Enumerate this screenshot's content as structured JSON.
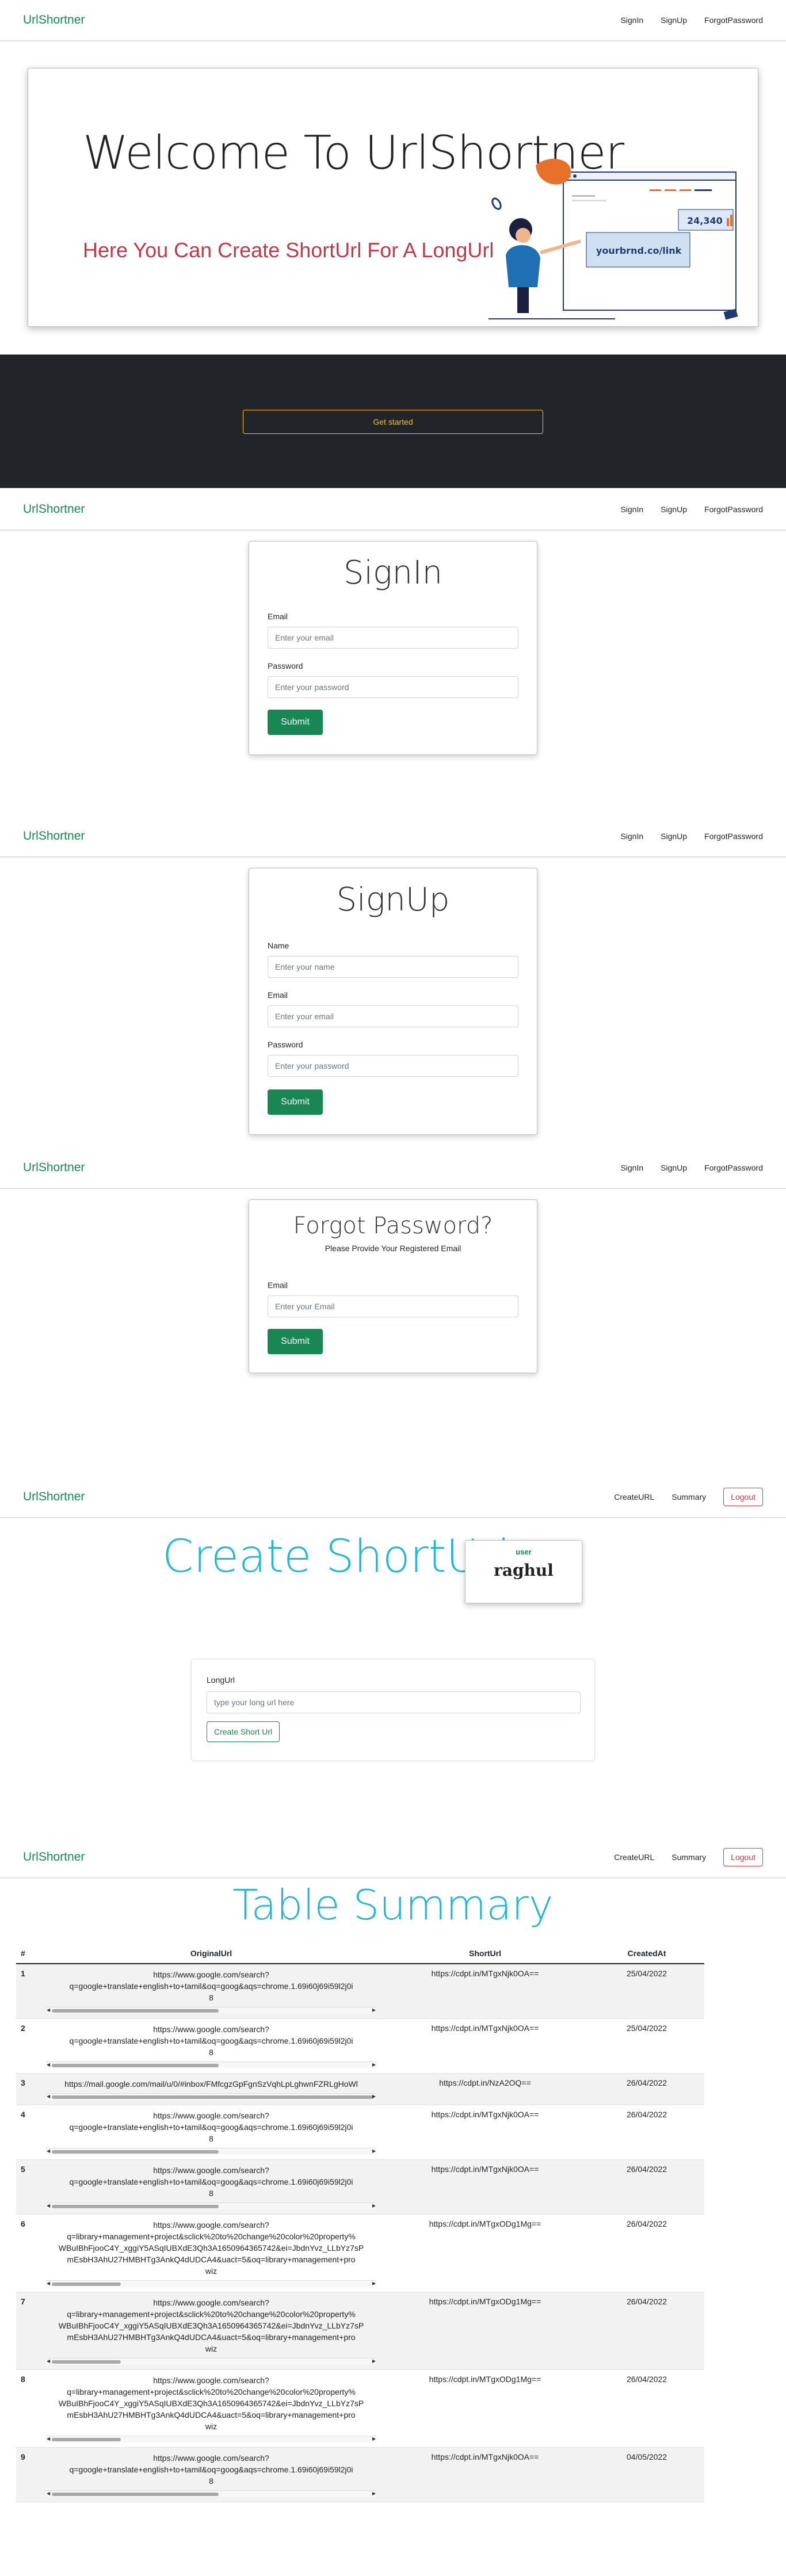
{
  "brand": "UrlShortner",
  "nav_public": {
    "signin": "SignIn",
    "signup": "SignUp",
    "forgot": "ForgotPassword"
  },
  "nav_private": {
    "create": "CreateURL",
    "summary": "Summary",
    "logout": "Logout"
  },
  "hero": {
    "title": "Welcome To UrlShortner",
    "subtitle": "Here You Can Create ShortUrl For A LongUrl",
    "illustration_link": "yourbrnd.co/link",
    "illustration_count": "24,340",
    "cta": "Get started"
  },
  "signin": {
    "title": "SignIn",
    "email_label": "Email",
    "email_placeholder": "Enter your email",
    "password_label": "Password",
    "password_placeholder": "Enter your password",
    "submit": "Submit"
  },
  "signup": {
    "title": "SignUp",
    "name_label": "Name",
    "name_placeholder": "Enter your name",
    "email_label": "Email",
    "email_placeholder": "Enter your email",
    "password_label": "Password",
    "password_placeholder": "Enter your password",
    "submit": "Submit"
  },
  "forgot": {
    "title": "Forgot Password?",
    "subtitle": "Please Provide Your Registered Email",
    "email_label": "Email",
    "email_placeholder": "Enter your Email",
    "submit": "Submit"
  },
  "create": {
    "title": "Create ShortUrl",
    "user_label": "user",
    "user_name": "raghul",
    "longurl_label": "LongUrl",
    "longurl_placeholder": "type your long url here",
    "button": "Create Short Url"
  },
  "summary": {
    "title": "Table Summary",
    "columns": [
      "#",
      "OriginalUrl",
      "ShortUrl",
      "CreatedAt"
    ],
    "rows": [
      {
        "n": "1",
        "l1": "https://www.google.com/search?",
        "l2": "q=google+translate+english+to+tamil&oq=goog&aqs=chrome.1.69i60j69i59l2j0i",
        "l3": "8",
        "short": "https://cdpt.in/MTgxNjk0OA==",
        "date": "25/04/2022"
      },
      {
        "n": "2",
        "l1": "https://www.google.com/search?",
        "l2": "q=google+translate+english+to+tamil&oq=goog&aqs=chrome.1.69i60j69i59l2j0i",
        "l3": "8",
        "short": "https://cdpt.in/MTgxNjk0OA==",
        "date": "25/04/2022"
      },
      {
        "n": "3",
        "l1": "https://mail.google.com/mail/u/0/#inbox/FMfcgzGpFgnSzVqhLpLghwnFZRLgHoWl",
        "l2": "",
        "l3": "",
        "short": "https://cdpt.in/NzA2OQ==",
        "date": "26/04/2022"
      },
      {
        "n": "4",
        "l1": "https://www.google.com/search?",
        "l2": "q=google+translate+english+to+tamil&oq=goog&aqs=chrome.1.69i60j69i59l2j0i",
        "l3": "8",
        "short": "https://cdpt.in/MTgxNjk0OA==",
        "date": "26/04/2022"
      },
      {
        "n": "5",
        "l1": "https://www.google.com/search?",
        "l2": "q=google+translate+english+to+tamil&oq=goog&aqs=chrome.1.69i60j69i59l2j0i",
        "l3": "8",
        "short": "https://cdpt.in/MTgxNjk0OA==",
        "date": "26/04/2022"
      },
      {
        "n": "6",
        "l1": "https://www.google.com/search?",
        "l2": "q=library+management+project&sclick%20to%20change%20color%20property%",
        "l3": "WBuIBhFjooC4Y_xggiY5ASqIUBXdE3Qh3A1650964365742&ei=JbdnYvz_LLbYz7sP",
        "l4": "mEsbH3AhU27HMBHTg3AnkQ4dUDCA4&uact=5&oq=library+management+pro",
        "l5": "wiz",
        "short": "https://cdpt.in/MTgxODg1Mg==",
        "date": "26/04/2022"
      },
      {
        "n": "7",
        "l1": "https://www.google.com/search?",
        "l2": "q=library+management+project&sclick%20to%20change%20color%20property%",
        "l3": "WBuIBhFjooC4Y_xggiY5ASqIUBXdE3Qh3A1650964365742&ei=JbdnYvz_LLbYz7sP",
        "l4": "mEsbH3AhU27HMBHTg3AnkQ4dUDCA4&uact=5&oq=library+management+pro",
        "l5": "wiz",
        "short": "https://cdpt.in/MTgxODg1Mg==",
        "date": "26/04/2022"
      },
      {
        "n": "8",
        "l1": "https://www.google.com/search?",
        "l2": "q=library+management+project&sclick%20to%20change%20color%20property%",
        "l3": "WBuIBhFjooC4Y_xggiY5ASqIUBXdE3Qh3A1650964365742&ei=JbdnYvz_LLbYz7sP",
        "l4": "mEsbH3AhU27HMBHTg3AnkQ4dUDCA4&uact=5&oq=library+management+pro",
        "l5": "wiz",
        "short": "https://cdpt.in/MTgxODg1Mg==",
        "date": "26/04/2022"
      },
      {
        "n": "9",
        "l1": "https://www.google.com/search?",
        "l2": "q=google+translate+english+to+tamil&oq=goog&aqs=chrome.1.69i60j69i59l2j0i",
        "l3": "8",
        "short": "https://cdpt.in/MTgxNjk0OA==",
        "date": "04/05/2022"
      }
    ]
  },
  "colors": {
    "brand_green": "#198754",
    "accent_cyan": "#23b8d4",
    "hero_subtitle": "#c0394b",
    "dark_band": "#212529",
    "warning": "#ffc107",
    "danger": "#dc3545"
  }
}
